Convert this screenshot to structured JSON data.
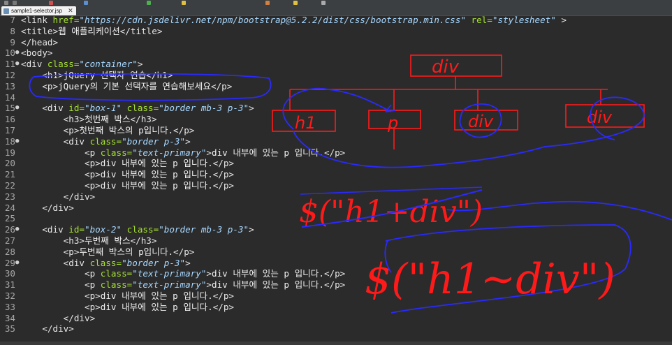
{
  "editor": {
    "tab": {
      "label": "sample1-selector.jsp",
      "close": "✕"
    },
    "lines": [
      {
        "num": "7",
        "fold": "",
        "code": [
          [
            "tg",
            "<link "
          ],
          [
            "at",
            "href="
          ],
          [
            "st",
            "\"https://cdn.jsdelivr.net/npm/bootstrap@5.2.2/dist/css/bootstrap.min.css\""
          ],
          [
            "at",
            " rel="
          ],
          [
            "st",
            "\"stylesheet\""
          ],
          [
            "tg",
            " >"
          ]
        ]
      },
      {
        "num": "8",
        "fold": "",
        "code": [
          [
            "tg",
            "<title>"
          ],
          [
            "tx",
            "웹 애플리케이션"
          ],
          [
            "tg",
            "</title>"
          ]
        ]
      },
      {
        "num": "9",
        "fold": "",
        "code": [
          [
            "tg",
            "</head>"
          ]
        ]
      },
      {
        "num": "10",
        "fold": "●",
        "code": [
          [
            "tg",
            "<body>"
          ]
        ]
      },
      {
        "num": "11",
        "fold": "●",
        "code": [
          [
            "tg",
            "<div "
          ],
          [
            "at",
            "class="
          ],
          [
            "st",
            "\"container\""
          ],
          [
            "tg",
            ">"
          ]
        ]
      },
      {
        "num": "12",
        "fold": "",
        "code": [
          [
            "tx",
            "    "
          ],
          [
            "tg",
            "<h1>"
          ],
          [
            "tx",
            "jQuery 선택자 연습"
          ],
          [
            "tg",
            "</h1>"
          ]
        ]
      },
      {
        "num": "13",
        "fold": "",
        "code": [
          [
            "tx",
            "    "
          ],
          [
            "tg",
            "<p>"
          ],
          [
            "tx",
            "jQuery의 기본 선택자를 연습해보세요"
          ],
          [
            "tg",
            "</p>"
          ]
        ]
      },
      {
        "num": "14",
        "fold": "",
        "code": []
      },
      {
        "num": "15",
        "fold": "●",
        "code": [
          [
            "tx",
            "    "
          ],
          [
            "tg",
            "<div "
          ],
          [
            "at",
            "id="
          ],
          [
            "st",
            "\"box-1\""
          ],
          [
            "at",
            " class="
          ],
          [
            "st",
            "\"border mb-3 p-3\""
          ],
          [
            "tg",
            ">"
          ]
        ]
      },
      {
        "num": "16",
        "fold": "",
        "code": [
          [
            "tx",
            "        "
          ],
          [
            "tg",
            "<h3>"
          ],
          [
            "tx",
            "첫번째 박스"
          ],
          [
            "tg",
            "</h3>"
          ]
        ]
      },
      {
        "num": "17",
        "fold": "",
        "code": [
          [
            "tx",
            "        "
          ],
          [
            "tg",
            "<p>"
          ],
          [
            "tx",
            "첫번째 박스의 p입니다."
          ],
          [
            "tg",
            "</p>"
          ]
        ]
      },
      {
        "num": "18",
        "fold": "●",
        "code": [
          [
            "tx",
            "        "
          ],
          [
            "tg",
            "<div "
          ],
          [
            "at",
            "class="
          ],
          [
            "st",
            "\"border p-3\""
          ],
          [
            "tg",
            ">"
          ]
        ]
      },
      {
        "num": "19",
        "fold": "",
        "code": [
          [
            "tx",
            "            "
          ],
          [
            "tg",
            "<p "
          ],
          [
            "at",
            "class="
          ],
          [
            "st",
            "\"text-primary\""
          ],
          [
            "tg",
            ">"
          ],
          [
            "tx",
            "div 내부에 있는 p 입니다."
          ],
          [
            "tg",
            "</p>"
          ]
        ]
      },
      {
        "num": "20",
        "fold": "",
        "code": [
          [
            "tx",
            "            "
          ],
          [
            "tg",
            "<p>"
          ],
          [
            "tx",
            "div 내부에 있는 p 입니다."
          ],
          [
            "tg",
            "</p>"
          ]
        ]
      },
      {
        "num": "21",
        "fold": "",
        "code": [
          [
            "tx",
            "            "
          ],
          [
            "tg",
            "<p>"
          ],
          [
            "tx",
            "div 내부에 있는 p 입니다."
          ],
          [
            "tg",
            "</p>"
          ]
        ]
      },
      {
        "num": "22",
        "fold": "",
        "code": [
          [
            "tx",
            "            "
          ],
          [
            "tg",
            "<p>"
          ],
          [
            "tx",
            "div 내부에 있는 p 입니다."
          ],
          [
            "tg",
            "</p>"
          ]
        ]
      },
      {
        "num": "23",
        "fold": "",
        "code": [
          [
            "tx",
            "        "
          ],
          [
            "tg",
            "</div>"
          ]
        ]
      },
      {
        "num": "24",
        "fold": "",
        "code": [
          [
            "tx",
            "    "
          ],
          [
            "tg",
            "</div>"
          ]
        ]
      },
      {
        "num": "25",
        "fold": "",
        "code": []
      },
      {
        "num": "26",
        "fold": "●",
        "code": [
          [
            "tx",
            "    "
          ],
          [
            "tg",
            "<div "
          ],
          [
            "at",
            "id="
          ],
          [
            "st",
            "\"box-2\""
          ],
          [
            "at",
            " class="
          ],
          [
            "st",
            "\"border mb-3 p-3\""
          ],
          [
            "tg",
            ">"
          ]
        ]
      },
      {
        "num": "27",
        "fold": "",
        "code": [
          [
            "tx",
            "        "
          ],
          [
            "tg",
            "<h3>"
          ],
          [
            "tx",
            "두번째 박스"
          ],
          [
            "tg",
            "</h3>"
          ]
        ]
      },
      {
        "num": "28",
        "fold": "",
        "code": [
          [
            "tx",
            "        "
          ],
          [
            "tg",
            "<p>"
          ],
          [
            "tx",
            "두번째 박스의 p입니다."
          ],
          [
            "tg",
            "</p>"
          ]
        ]
      },
      {
        "num": "29",
        "fold": "●",
        "code": [
          [
            "tx",
            "        "
          ],
          [
            "tg",
            "<div "
          ],
          [
            "at",
            "class="
          ],
          [
            "st",
            "\"border p-3\""
          ],
          [
            "tg",
            ">"
          ]
        ]
      },
      {
        "num": "30",
        "fold": "",
        "code": [
          [
            "tx",
            "            "
          ],
          [
            "tg",
            "<p "
          ],
          [
            "at",
            "class="
          ],
          [
            "st",
            "\"text-primary\""
          ],
          [
            "tg",
            ">"
          ],
          [
            "tx",
            "div 내부에 있는 p 입니다."
          ],
          [
            "tg",
            "</p>"
          ]
        ]
      },
      {
        "num": "31",
        "fold": "",
        "code": [
          [
            "tx",
            "            "
          ],
          [
            "tg",
            "<p "
          ],
          [
            "at",
            "class="
          ],
          [
            "st",
            "\"text-primary\""
          ],
          [
            "tg",
            ">"
          ],
          [
            "tx",
            "div 내부에 있는 p 입니다."
          ],
          [
            "tg",
            "</p>"
          ]
        ]
      },
      {
        "num": "32",
        "fold": "",
        "code": [
          [
            "tx",
            "            "
          ],
          [
            "tg",
            "<p>"
          ],
          [
            "tx",
            "div 내부에 있는 p 입니다."
          ],
          [
            "tg",
            "</p>"
          ]
        ]
      },
      {
        "num": "33",
        "fold": "",
        "code": [
          [
            "tx",
            "            "
          ],
          [
            "tg",
            "<p>"
          ],
          [
            "tx",
            "div 내부에 있는 p 입니다."
          ],
          [
            "tg",
            "</p>"
          ]
        ]
      },
      {
        "num": "34",
        "fold": "",
        "code": [
          [
            "tx",
            "        "
          ],
          [
            "tg",
            "</div>"
          ]
        ]
      },
      {
        "num": "35",
        "fold": "",
        "code": [
          [
            "tx",
            "    "
          ],
          [
            "tg",
            "</div>"
          ]
        ]
      }
    ]
  },
  "annotations": {
    "tree_root": "div",
    "tree_children": [
      "h1",
      "p",
      "div",
      "div"
    ],
    "struck_selector": "$(\"h1+div\")",
    "selector": "$(\"h1~div\")",
    "ink_colors": {
      "red": "#ff1a1a",
      "blue": "#2a2aff"
    }
  }
}
